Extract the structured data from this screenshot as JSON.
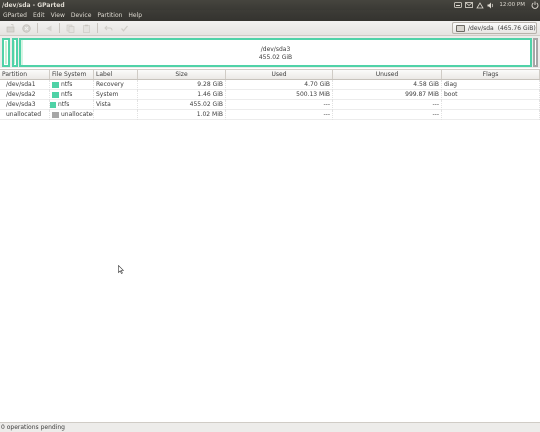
{
  "window": {
    "title": "/dev/sda - GParted"
  },
  "tray": {
    "clock": "12:00 PM"
  },
  "menu": [
    "GParted",
    "Edit",
    "View",
    "Device",
    "Partition",
    "Help"
  ],
  "device": {
    "name": "/dev/sda",
    "size": "(465.76 GiB)"
  },
  "diskmap": {
    "main_partition": "/dev/sda3",
    "main_size": "455.02 GiB"
  },
  "colors": {
    "ntfs": "#4fd2a6",
    "unallocated": "#a7a7a7",
    "warning": "#d92b20"
  },
  "columns": [
    "Partition",
    "File System",
    "Label",
    "Size",
    "Used",
    "Unused",
    "Flags"
  ],
  "rows": [
    {
      "partition": "/dev/sda1",
      "fs": "ntfs",
      "label": "Recovery",
      "size": "9.28 GiB",
      "used": "4.70 GiB",
      "unused": "4.58 GiB",
      "flags": "diag"
    },
    {
      "partition": "/dev/sda2",
      "fs": "ntfs",
      "label": "System",
      "size": "1.46 GiB",
      "used": "500.13 MiB",
      "unused": "999.87 MiB",
      "flags": "boot"
    },
    {
      "partition": "/dev/sda3",
      "fs": "ntfs",
      "label": "Vista",
      "size": "455.02 GiB",
      "used": "---",
      "unused": "---",
      "flags": ""
    },
    {
      "partition": "unallocated",
      "fs": "unallocated",
      "label": "",
      "size": "1.02 MiB",
      "used": "---",
      "unused": "---",
      "flags": ""
    }
  ],
  "status": "0 operations pending"
}
